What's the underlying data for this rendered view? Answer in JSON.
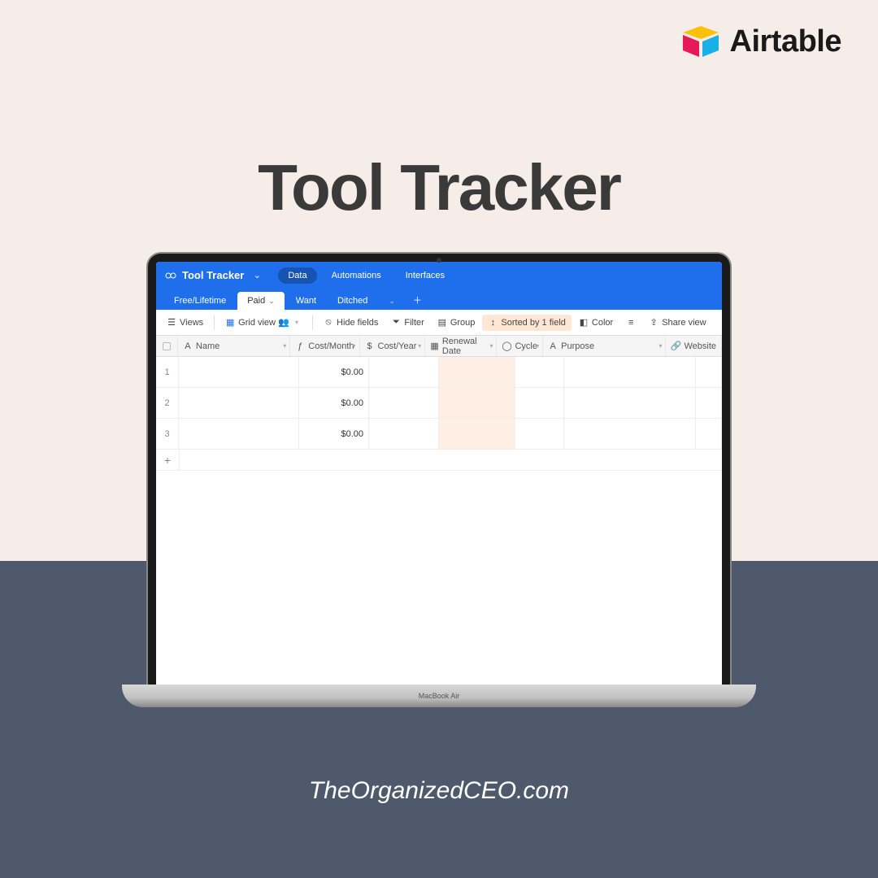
{
  "brand": {
    "name": "Airtable"
  },
  "page_title": "Tool Tracker",
  "footer_url": "TheOrganizedCEO.com",
  "laptop_model": "MacBook Air",
  "airtable": {
    "base_name": "Tool Tracker",
    "nav": {
      "data": "Data",
      "automations": "Automations",
      "interfaces": "Interfaces"
    },
    "table_tabs": [
      "Free/Lifetime",
      "Paid",
      "Want",
      "Ditched"
    ],
    "active_table_tab": "Paid",
    "toolbar": {
      "views": "Views",
      "grid_view": "Grid view",
      "hide_fields": "Hide fields",
      "filter": "Filter",
      "group": "Group",
      "sorted": "Sorted by 1 field",
      "color": "Color",
      "share": "Share view"
    },
    "columns": {
      "name": "Name",
      "cost_month": "Cost/Month",
      "cost_year": "Cost/Year",
      "renewal_date": "Renewal Date",
      "cycle": "Cycle",
      "purpose": "Purpose",
      "website": "Website"
    },
    "rows": [
      {
        "num": "1",
        "cost_month": "$0.00"
      },
      {
        "num": "2",
        "cost_month": "$0.00"
      },
      {
        "num": "3",
        "cost_month": "$0.00"
      }
    ]
  }
}
